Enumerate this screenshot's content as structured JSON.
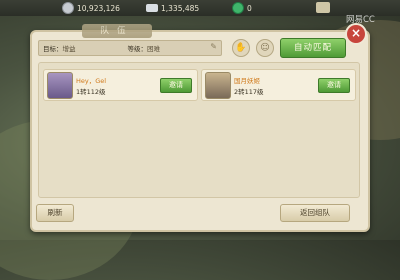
{
  "resources": [
    {
      "icon": "silver-coin-icon",
      "value": "10,923,126",
      "color": "#c7cbd1"
    },
    {
      "icon": "silver-ingot-icon",
      "value": "1,335,485",
      "color": "#d9dee3"
    },
    {
      "icon": "jade-icon",
      "value": "0",
      "color": "#3fb56b"
    }
  ],
  "watermark": "网易CC",
  "panel": {
    "title": "队伍",
    "filter": {
      "target_label": "目标：",
      "target_value": "增益",
      "level_label": "等级：",
      "level_value": "困难"
    },
    "auto_match_label": "自动匹配",
    "players": [
      {
        "name": "Hey，Gel",
        "info": "1转112级",
        "invite_label": "邀请",
        "avatar_color": "#6a5a8a"
      },
      {
        "name": "国月妖姬",
        "info": "2转117级",
        "invite_label": "邀请",
        "avatar_color": "#7a6a58"
      }
    ],
    "refresh_label": "刷新",
    "return_label": "返回组队"
  },
  "colors": {
    "accent_green": "#4f9a36",
    "panel_bg": "#ede6d2",
    "close_red": "#c7453c",
    "name_orange": "#d07a1c"
  }
}
